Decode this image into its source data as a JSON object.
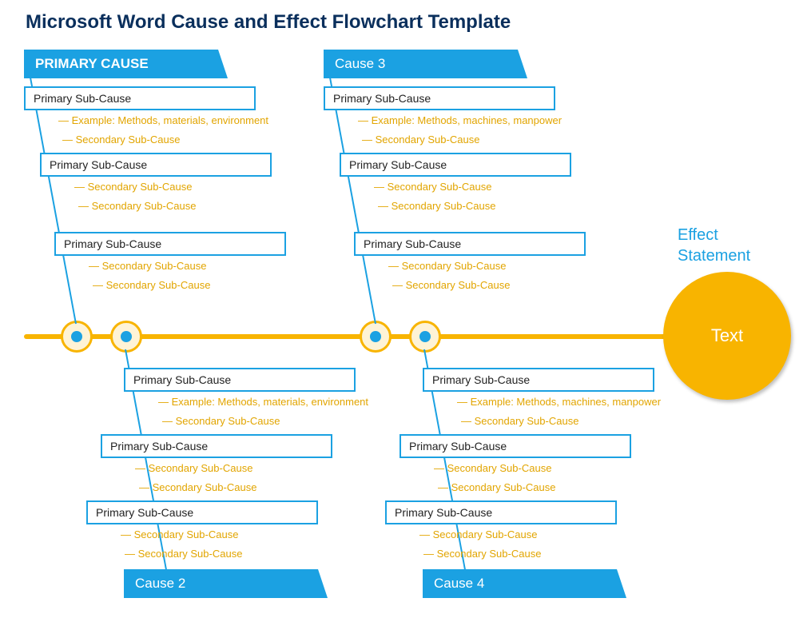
{
  "title": "Microsoft Word Cause and Effect Flowchart Template",
  "effect": {
    "label": "Effect Statement",
    "text": "Text"
  },
  "causes": {
    "c1": {
      "header": "PRIMARY CAUSE",
      "sub1": {
        "box": "Primary Sub-Cause",
        "s1": "Example: Methods, materials, environment",
        "s2": "Secondary Sub-Cause"
      },
      "sub2": {
        "box": "Primary Sub-Cause",
        "s1": "Secondary Sub-Cause",
        "s2": "Secondary Sub-Cause"
      },
      "sub3": {
        "box": "Primary Sub-Cause",
        "s1": "Secondary Sub-Cause",
        "s2": "Secondary Sub-Cause"
      }
    },
    "c2": {
      "header": "Cause 2",
      "sub1": {
        "box": "Primary Sub-Cause",
        "s1": "Example: Methods, materials, environment",
        "s2": "Secondary Sub-Cause"
      },
      "sub2": {
        "box": "Primary Sub-Cause",
        "s1": "Secondary Sub-Cause",
        "s2": "Secondary Sub-Cause"
      },
      "sub3": {
        "box": "Primary Sub-Cause",
        "s1": "Secondary Sub-Cause",
        "s2": "Secondary Sub-Cause"
      }
    },
    "c3": {
      "header": "Cause 3",
      "sub1": {
        "box": "Primary Sub-Cause",
        "s1": "Example: Methods, machines, manpower",
        "s2": "Secondary Sub-Cause"
      },
      "sub2": {
        "box": "Primary Sub-Cause",
        "s1": "Secondary Sub-Cause",
        "s2": "Secondary Sub-Cause"
      },
      "sub3": {
        "box": "Primary Sub-Cause",
        "s1": "Secondary Sub-Cause",
        "s2": "Secondary Sub-Cause"
      }
    },
    "c4": {
      "header": "Cause 4",
      "sub1": {
        "box": "Primary Sub-Cause",
        "s1": "Example: Methods, machines, manpower",
        "s2": "Secondary Sub-Cause"
      },
      "sub2": {
        "box": "Primary Sub-Cause",
        "s1": "Secondary Sub-Cause",
        "s2": "Secondary Sub-Cause"
      },
      "sub3": {
        "box": "Primary Sub-Cause",
        "s1": "Secondary Sub-Cause",
        "s2": "Secondary Sub-Cause"
      }
    }
  }
}
